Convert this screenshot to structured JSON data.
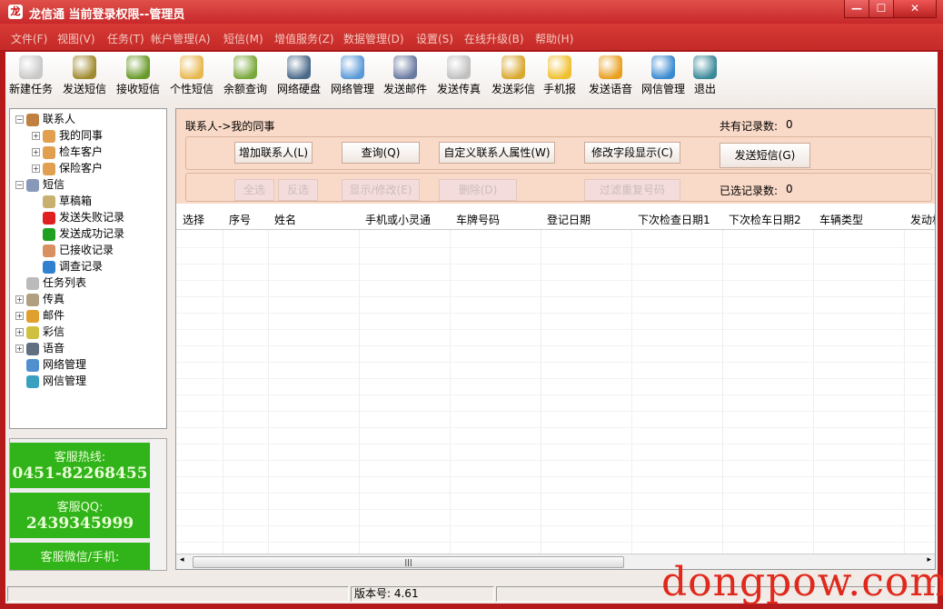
{
  "window": {
    "title": "龙信通  当前登录权限--管理员",
    "minimize": "—",
    "maximize": "☐",
    "close": "✕"
  },
  "menu": [
    "文件(F)",
    "视图(V)",
    "任务(T)",
    "帐户管理(A)",
    "短信(M)",
    "增值服务(Z)",
    "数据管理(D)",
    "设置(S)",
    "在线升级(B)",
    "帮助(H)"
  ],
  "toolbar": [
    {
      "label": "新建任务",
      "icon": "new-task-icon",
      "color": "#c8c8c8"
    },
    {
      "label": "发送短信",
      "icon": "send-sms-icon",
      "color": "#a08a30"
    },
    {
      "label": "接收短信",
      "icon": "receive-sms-icon",
      "color": "#6a9a2a"
    },
    {
      "label": "个性短信",
      "icon": "custom-sms-icon",
      "color": "#e8b850"
    },
    {
      "label": "余额查询",
      "icon": "balance-icon",
      "color": "#7aa83a"
    },
    {
      "label": "网络硬盘",
      "icon": "network-disk-icon",
      "color": "#4a6a8a"
    },
    {
      "label": "网络管理",
      "icon": "network-manage-icon",
      "color": "#5a9ad8"
    },
    {
      "label": "发送邮件",
      "icon": "send-mail-icon",
      "color": "#6a7aa0"
    },
    {
      "label": "发送传真",
      "icon": "send-fax-icon",
      "color": "#c0c0c0"
    },
    {
      "label": "发送彩信",
      "icon": "send-mms-icon",
      "color": "#d8a830"
    },
    {
      "label": "手机报",
      "icon": "mobile-news-icon",
      "color": "#f0c030"
    },
    {
      "label": "发送语音",
      "icon": "send-voice-icon",
      "color": "#e8a020"
    },
    {
      "label": "网信管理",
      "icon": "web-msg-icon",
      "color": "#3a8ad0"
    },
    {
      "label": "退出",
      "icon": "exit-icon",
      "color": "#3a8a9a"
    }
  ],
  "tree": [
    {
      "label": "联系人",
      "level": 0,
      "exp": "−",
      "icon": "contacts-icon",
      "color": "#c08040"
    },
    {
      "label": "我的同事",
      "level": 1,
      "exp": "+",
      "icon": "person-icon",
      "color": "#e0a050"
    },
    {
      "label": "检车客户",
      "level": 1,
      "exp": "+",
      "icon": "person-icon",
      "color": "#e0a050"
    },
    {
      "label": "保险客户",
      "level": 1,
      "exp": "+",
      "icon": "person-icon",
      "color": "#e0a050"
    },
    {
      "label": "短信",
      "level": 0,
      "exp": "−",
      "icon": "sms-icon",
      "color": "#8898b8"
    },
    {
      "label": "草稿箱",
      "level": 1,
      "exp": "",
      "icon": "draft-icon",
      "color": "#c8b070"
    },
    {
      "label": "发送失败记录",
      "level": 1,
      "exp": "",
      "icon": "fail-x-icon",
      "color": "#e02020"
    },
    {
      "label": "发送成功记录",
      "level": 1,
      "exp": "",
      "icon": "success-check-icon",
      "color": "#20a020"
    },
    {
      "label": "已接收记录",
      "level": 1,
      "exp": "",
      "icon": "received-icon",
      "color": "#d89060"
    },
    {
      "label": "调查记录",
      "level": 1,
      "exp": "",
      "icon": "survey-icon",
      "color": "#3080d0"
    },
    {
      "label": "任务列表",
      "level": 0,
      "exp": "",
      "icon": "task-list-icon",
      "color": "#bbbbbb"
    },
    {
      "label": "传真",
      "level": 0,
      "exp": "+",
      "icon": "fax-icon",
      "color": "#b0a080"
    },
    {
      "label": "邮件",
      "level": 0,
      "exp": "+",
      "icon": "mail-icon",
      "color": "#e0a030"
    },
    {
      "label": "彩信",
      "level": 0,
      "exp": "+",
      "icon": "mms-icon",
      "color": "#d0c040"
    },
    {
      "label": "语音",
      "level": 0,
      "exp": "+",
      "icon": "voice-icon",
      "color": "#607080"
    },
    {
      "label": "网络管理",
      "level": 0,
      "exp": "",
      "icon": "network-icon",
      "color": "#5090d0"
    },
    {
      "label": "网信管理",
      "level": 0,
      "exp": "",
      "icon": "globe-icon",
      "color": "#3aa0c0"
    }
  ],
  "service": [
    {
      "label": "客服热线:",
      "value": "0451-82268455"
    },
    {
      "label": "客服QQ:",
      "value": "2439345999"
    },
    {
      "label": "客服微信/手机:",
      "value": ""
    }
  ],
  "main": {
    "breadcrumb": "联系人->我的同事",
    "total_label": "共有记录数:",
    "total": "0",
    "selected_label": "已选记录数:",
    "selected": "0",
    "buttons": [
      "增加联系人(L)",
      "查询(Q)",
      "自定义联系人属性(W)",
      "修改字段显示(C)",
      "发送短信(G)"
    ],
    "disabled_buttons": [
      "全选",
      "反选",
      "显示/修改(E)",
      "删除(D)",
      "过滤重复号码"
    ],
    "columns": [
      "选择",
      "序号",
      "姓名",
      "手机或小灵通",
      "车牌号码",
      "登记日期",
      "下次检查日期1",
      "下次检车日期2",
      "车辆类型",
      "发动机"
    ]
  },
  "status": {
    "version": "版本号: 4.61"
  },
  "watermark": "dongpow.com"
}
